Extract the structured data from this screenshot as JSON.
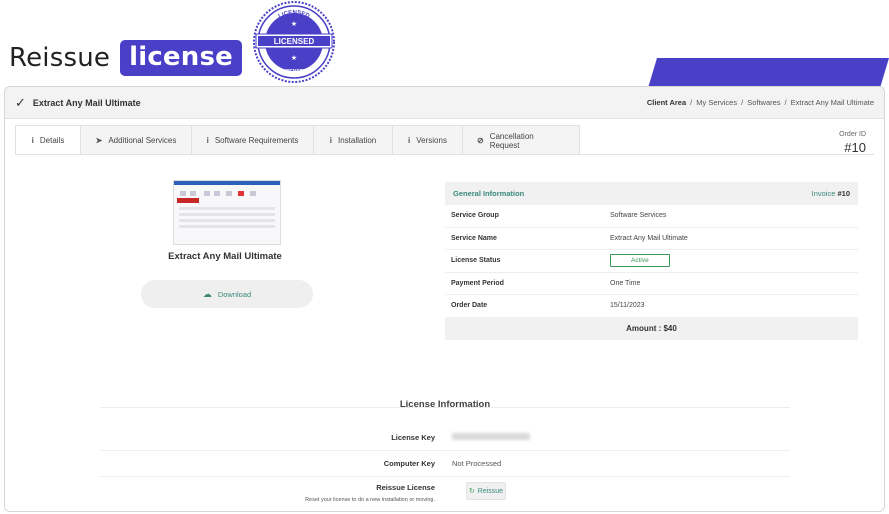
{
  "hero": {
    "title": "Reissue",
    "highlight": "license"
  },
  "seal": {
    "top_text": "LICENSED",
    "banner": "LICENSED",
    "bottom_text": "LICENSED",
    "accent": "#4a3fc7"
  },
  "header": {
    "product": "Extract Any Mail Ultimate",
    "breadcrumbs": [
      "Client Area",
      "/",
      "My Services",
      "/",
      "Softwares",
      "/",
      "Extract Any Mail Ultimate"
    ]
  },
  "tabs": [
    {
      "icon": "info-icon",
      "label": "Details"
    },
    {
      "icon": "rocket-icon",
      "label": "Additional Services"
    },
    {
      "icon": "info-icon",
      "label": "Software Requirements"
    },
    {
      "icon": "info-icon",
      "label": "Installation"
    },
    {
      "icon": "info-icon",
      "label": "Versions"
    },
    {
      "icon": "ban-icon",
      "label": "Cancellation Request"
    }
  ],
  "order": {
    "label": "Order ID",
    "number": "#10"
  },
  "product": {
    "name": "Extract Any Mail Ultimate",
    "download_label": "Download"
  },
  "general": {
    "title": "General Information",
    "invoice_label": "Invoice",
    "invoice_number": "#10",
    "rows": [
      {
        "key": "Service Group",
        "value": "Software Services"
      },
      {
        "key": "Service Name",
        "value": "Extract Any Mail Ultimate"
      },
      {
        "key": "License Status",
        "value": "Active"
      },
      {
        "key": "Payment Period",
        "value": "One Time"
      },
      {
        "key": "Order Date",
        "value": "15/11/2023"
      }
    ],
    "amount": "Amount : $40"
  },
  "license": {
    "title": "License Information",
    "key_label": "License Key",
    "computer_key_label": "Computer Key",
    "computer_key_value": "Not Processed",
    "reissue_label": "Reissue License",
    "reissue_sub": "Reset your license to do a new installation or moving.",
    "reissue_button": "Reissue"
  },
  "colors": {
    "brand": "#4a3fc7",
    "accent_teal": "#3a8a7a",
    "status_green": "#3c9a56"
  }
}
